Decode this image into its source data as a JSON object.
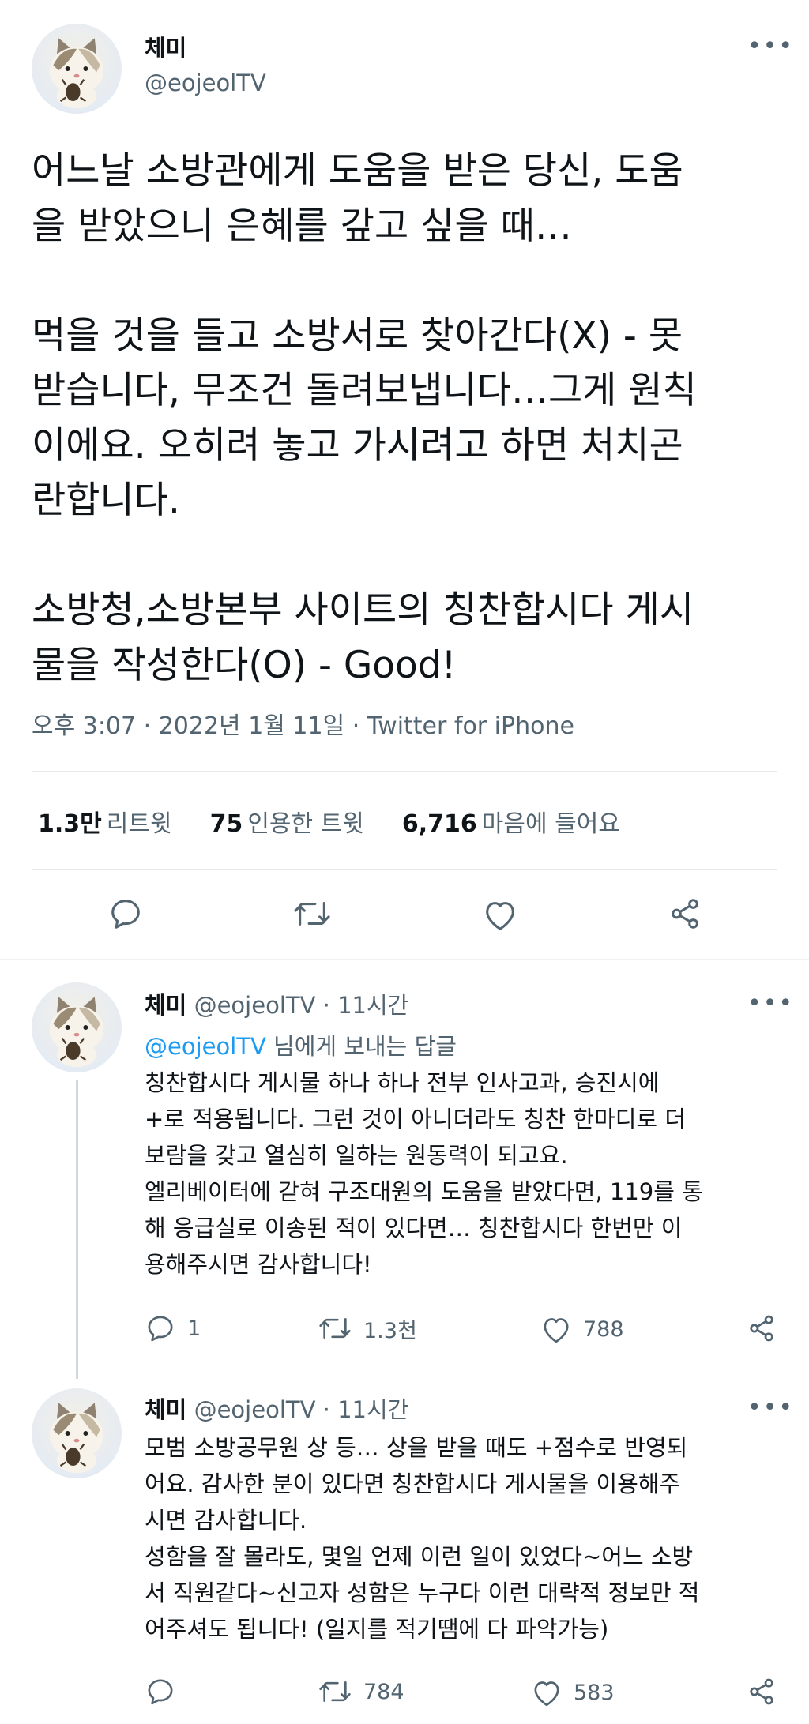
{
  "main_tweet": {
    "author_name": "체미",
    "author_handle": "@eojeolTV",
    "text": "어느날 소방관에게 도움을 받은 당신, 도움\n을 받았으니 은혜를 갚고 싶을 때…\n\n먹을 것을 들고 소방서로 찾아간다(X) - 못\n받습니다, 무조건 돌려보냅니다…그게 원칙\n이에요. 오히려 놓고 가시려고 하면 처치곤\n란합니다.\n\n소방청,소방본부 사이트의 칭찬합시다 게시\n물을 작성한다(O) - Good!",
    "meta": "오후 3:07 · 2022년 1월 11일 · Twitter for iPhone",
    "stats": {
      "retweets_value": "1.3만",
      "retweets_label": "리트윗",
      "quotes_value": "75",
      "quotes_label": "인용한 트윗",
      "likes_value": "6,716",
      "likes_label": "마음에 들어요"
    }
  },
  "replies": [
    {
      "author_name": "체미",
      "meta": "@eojeolTV · 11시간",
      "replying_mention": "@eojeolTV",
      "replying_suffix": " 님에게 보내는 답글",
      "text": "칭찬합시다 게시물 하나 하나 전부 인사고과, 승진시에\n+로 적용됩니다. 그런 것이 아니더라도 칭찬 한마디로 더\n보람을 갖고 열심히 일하는 원동력이 되고요.\n엘리베이터에 갇혀 구조대원의 도움을 받았다면, 119를 통\n해 응급실로 이송된 적이 있다면… 칭찬합시다 한번만 이\n용해주시면 감사합니다!",
      "reply_count": "1",
      "retweet_count": "1.3천",
      "like_count": "788"
    },
    {
      "author_name": "체미",
      "meta": "@eojeolTV · 11시간",
      "text": "모범 소방공무원 상 등… 상을 받을 때도 +점수로 반영되\n어요. 감사한 분이 있다면 칭찬합시다 게시물을 이용해주\n시면 감사합니다.\n성함을 잘 몰라도, 몇일 언제 이런 일이 있었다~어느 소방\n서 직원같다~신고자 성함은 누구다 이런 대략적 정보만 적\n어주셔도 됩니다! (일지를 적기땜에 다 파악가능)",
      "reply_count": "",
      "retweet_count": "784",
      "like_count": "583"
    }
  ],
  "icons": [
    "avatar-cat",
    "more-icon",
    "reply-icon",
    "retweet-icon",
    "like-icon",
    "share-icon"
  ],
  "colors": {
    "text": "#0f1419",
    "secondary": "#536471",
    "link": "#1d9bf0",
    "divider": "#e6e9eb"
  }
}
